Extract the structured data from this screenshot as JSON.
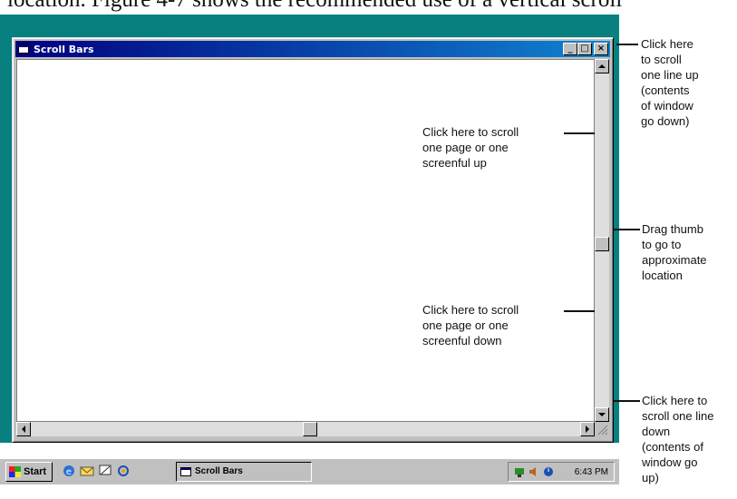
{
  "book": {
    "text": "location. Figure 4-7 shows the recommended use of a vertical scroll"
  },
  "window": {
    "title": "Scroll Bars",
    "minimize_label": "_",
    "maximize_label": "□",
    "close_label": "×"
  },
  "taskbar": {
    "start_label": "Start",
    "task_label": "Scroll Bars",
    "clock": "6:43 PM"
  },
  "callouts": {
    "scroll_line_up": [
      "Click here",
      "to scroll",
      "one line up",
      "(contents",
      "of window",
      "go down)"
    ],
    "scroll_page_up": [
      "Click here to scroll",
      "one page or one",
      "screenful up"
    ],
    "drag_thumb": [
      "Drag thumb",
      "to go to",
      "approximate",
      "location"
    ],
    "scroll_page_down": [
      "Click here to scroll",
      "one page or one",
      "screenful down"
    ],
    "scroll_line_down": [
      "Click here to",
      "scroll one line",
      "down",
      "(contents of",
      "window go",
      "up)"
    ]
  },
  "icons": {
    "title": "window-app-icon",
    "start": "windows-logo-icon",
    "quicklaunch": [
      "internet-explorer-icon",
      "outlook-express-icon",
      "desktop-icon",
      "channels-icon"
    ],
    "tray": [
      "network-icon",
      "volume-icon",
      "scheduler-icon"
    ]
  },
  "colors": {
    "desktop": "#088080",
    "titlebar": "#000080",
    "chrome": "#c0c0c0"
  }
}
